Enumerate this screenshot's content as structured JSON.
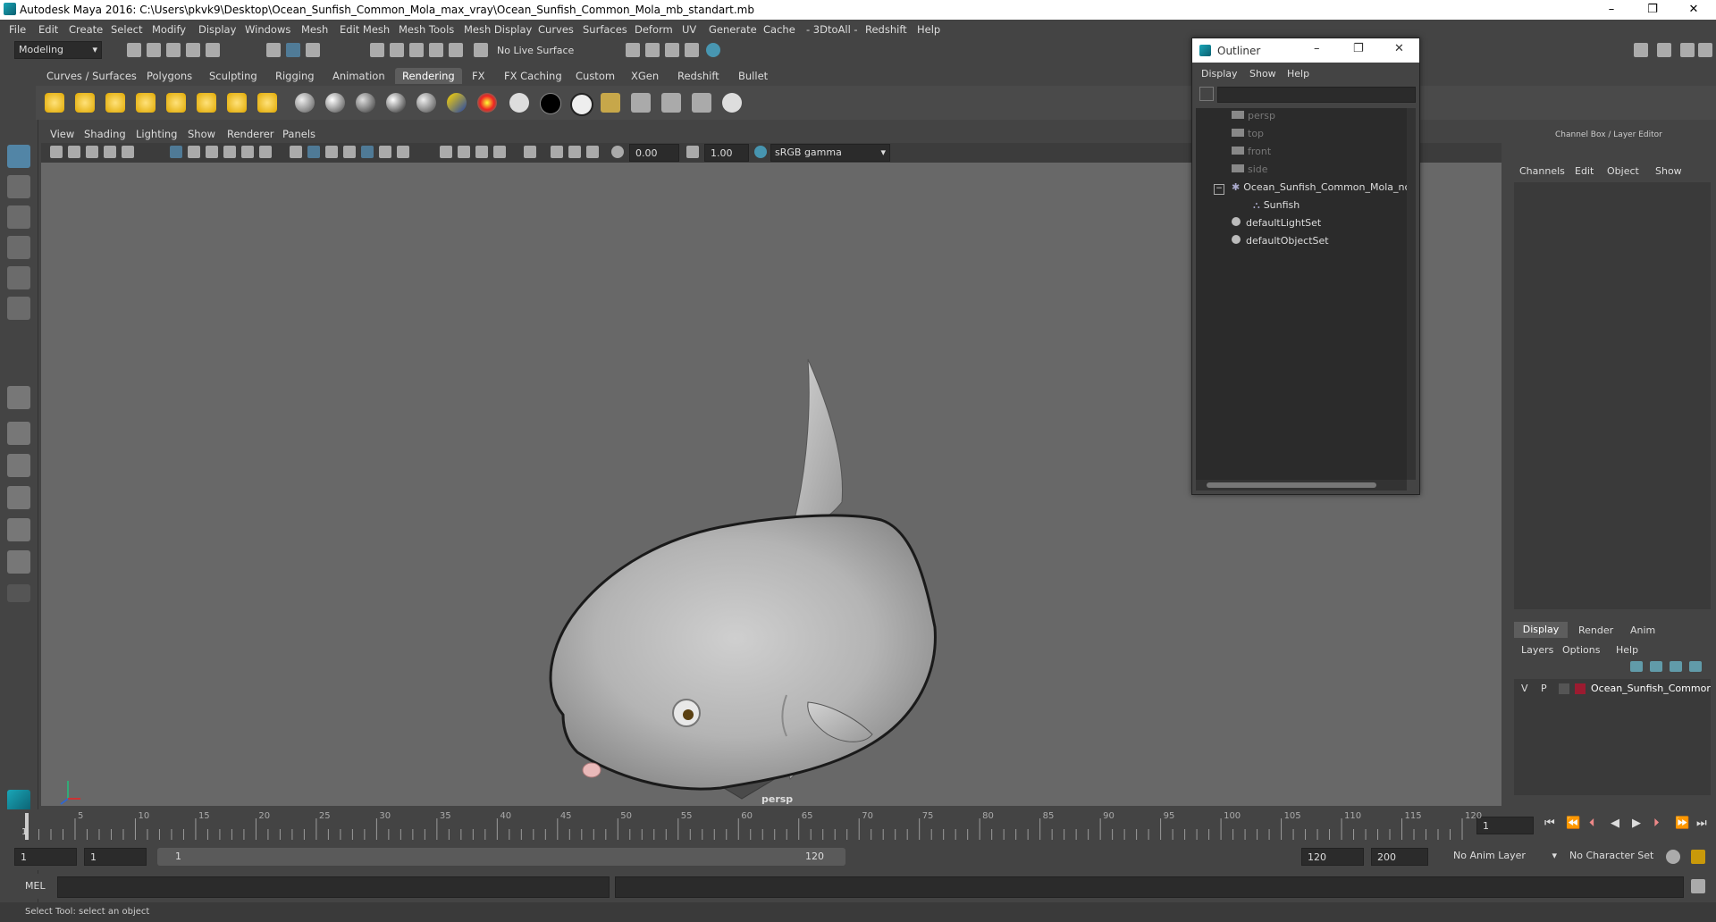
{
  "window": {
    "title": "Autodesk Maya 2016: C:\\Users\\pkvk9\\Desktop\\Ocean_Sunfish_Common_Mola_max_vray\\Ocean_Sunfish_Common_Mola_mb_standart.mb",
    "minimize": "–",
    "maximize": "❐",
    "close": "✕"
  },
  "menubar": [
    "File",
    "Edit",
    "Create",
    "Select",
    "Modify",
    "Display",
    "Windows",
    "Mesh",
    "Edit Mesh",
    "Mesh Tools",
    "Mesh Display",
    "Curves",
    "Surfaces",
    "Deform",
    "UV",
    "Generate",
    "Cache",
    "- 3DtoAll -",
    "Redshift",
    "Help"
  ],
  "status": {
    "mode": "Modeling",
    "live_surface": "No Live Surface"
  },
  "shelf_tabs": [
    "Curves / Surfaces",
    "Polygons",
    "Sculpting",
    "Rigging",
    "Animation",
    "Rendering",
    "FX",
    "FX Caching",
    "Custom",
    "XGen",
    "Redshift",
    "Bullet"
  ],
  "shelf_active": "Rendering",
  "viewport": {
    "menus": [
      "View",
      "Shading",
      "Lighting",
      "Show",
      "Renderer",
      "Panels"
    ],
    "exposure": "0.00",
    "gamma": "1.00",
    "colorspace": "sRGB gamma",
    "camera_label": "persp"
  },
  "outliner": {
    "title": "Outliner",
    "menus": [
      "Display",
      "Show",
      "Help"
    ],
    "items": [
      {
        "label": "persp",
        "dim": true
      },
      {
        "label": "top",
        "dim": true
      },
      {
        "label": "front",
        "dim": true
      },
      {
        "label": "side",
        "dim": true
      },
      {
        "label": "Ocean_Sunfish_Common_Mola_nc",
        "dim": false
      },
      {
        "label": "Sunfish",
        "dim": false
      },
      {
        "label": "defaultLightSet",
        "dim": false
      },
      {
        "label": "defaultObjectSet",
        "dim": false
      }
    ]
  },
  "channel_box": {
    "title": "Channel Box / Layer Editor",
    "menus": [
      "Channels",
      "Edit",
      "Object",
      "Show"
    ]
  },
  "layer_editor": {
    "tabs": [
      "Display",
      "Render",
      "Anim"
    ],
    "menus": [
      "Layers",
      "Options",
      "Help"
    ],
    "layer": {
      "v": "V",
      "p": "P",
      "name": "Ocean_Sunfish_Commor",
      "color": "#9b1b30"
    }
  },
  "timeline": {
    "ticks": [
      "5",
      "10",
      "15",
      "20",
      "25",
      "30",
      "35",
      "40",
      "45",
      "50",
      "55",
      "60",
      "65",
      "70",
      "75",
      "80",
      "85",
      "90",
      "95",
      "100",
      "105",
      "110",
      "115",
      "120"
    ],
    "start_marker": "1",
    "current": "1"
  },
  "range": {
    "start": "1",
    "start2": "1",
    "slider_start": "1",
    "slider_end": "120",
    "end": "120",
    "end2": "200",
    "anim_layer": "No Anim Layer",
    "char_set": "No Character Set"
  },
  "cmdline": {
    "label": "MEL"
  },
  "help": "Select Tool: select an object",
  "colors": {
    "accent": "#5285a6",
    "maya_teal": "#1aa6b7"
  }
}
